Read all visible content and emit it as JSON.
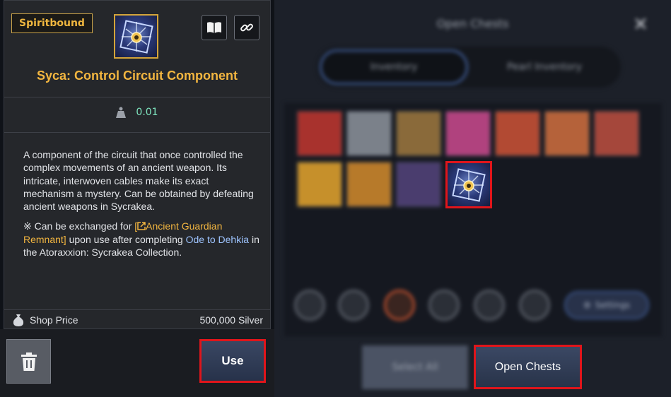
{
  "tooltip": {
    "badge": "Spiritbound",
    "item_name": "Syca: Control Circuit Component",
    "weight": "0.01",
    "description": "A component of the circuit that once controlled the complex movements of an ancient weapon. Its intricate, interwoven cables make its exact mechanism a mystery. Can be obtained by defeating ancient weapons in Sycrakea.",
    "note_prefix": "※ Can be exchanged for ",
    "note_link": "[",
    "note_link_name": "Ancient Guardian Remnant]",
    "note_middle": " upon use after completing ",
    "note_quest": "Ode to Dehkia",
    "note_suffix": " in the Atoraxxion: Sycrakea Collection.",
    "price_label": "Shop Price",
    "price_value": "500,000 Silver",
    "icons": {
      "book": "book-icon",
      "link": "link-icon",
      "weight": "weight-icon",
      "money": "money-bag-icon",
      "trash": "trash-icon"
    },
    "colors": {
      "badge": "#f0b73f",
      "title": "#f3b640",
      "weight": "#7fe6c0",
      "link": "#9ec4ff"
    }
  },
  "actions": {
    "use_label": "Use"
  },
  "chest_window": {
    "title": "Open Chests",
    "tabs": [
      "Inventory",
      "Pearl Inventory"
    ],
    "settings_label": "Settings",
    "select_all_label": "Select All",
    "open_label": "Open Chests",
    "slot_colors": [
      "#a8322d",
      "#7b818a",
      "#8a6a3a",
      "#b0427e",
      "#b24a33",
      "#b5623a",
      "#a5473b",
      "#c6902b",
      "#b77a2a",
      "#b4539a"
    ],
    "highlight_color": "#e0151b"
  }
}
